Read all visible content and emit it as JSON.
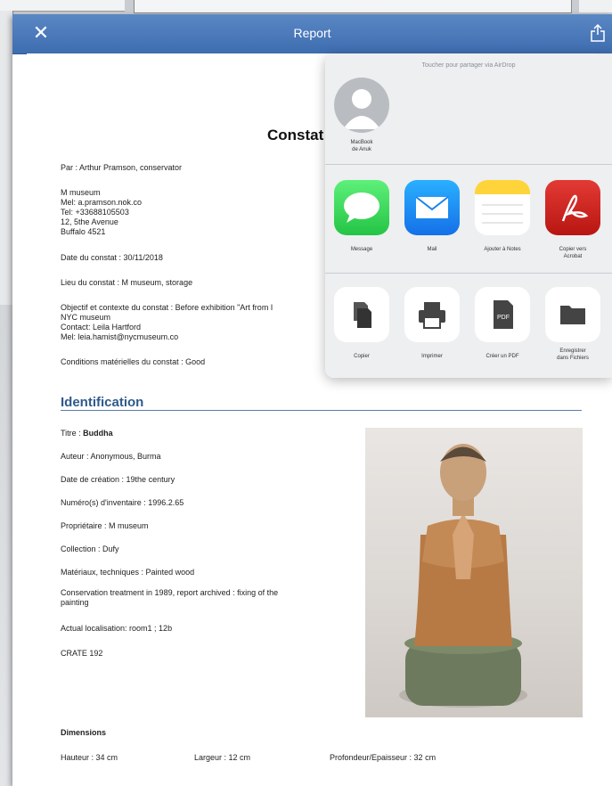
{
  "navbar": {
    "title": "Report"
  },
  "share_sheet": {
    "hint": "Toucher pour partager via AirDrop",
    "airdrop_person": {
      "line1": "MacBook",
      "line2": "de Anuk"
    },
    "apps": [
      {
        "label": "Message",
        "icon": "message-icon",
        "color": "#34c759"
      },
      {
        "label": "Mail",
        "icon": "mail-icon",
        "color": "#1a82f5"
      },
      {
        "label": "Ajouter à Notes",
        "icon": "notes-icon",
        "color": "#ffd43a"
      },
      {
        "label_line1": "Copier vers",
        "label_line2": "Acrobat",
        "icon": "acrobat-icon",
        "color": "#d9231f"
      }
    ],
    "actions": [
      {
        "label": "Copier",
        "icon": "copy-icon"
      },
      {
        "label": "Imprimer",
        "icon": "print-icon"
      },
      {
        "label": "Créer un PDF",
        "icon": "pdf-icon",
        "icon_text": "PDF"
      },
      {
        "label_line1": "Enregistrer",
        "label_line2": "dans Fichiers",
        "icon": "folder-icon"
      }
    ]
  },
  "report": {
    "title": "Constat",
    "author": "Par : Arthur Pramson, conservator",
    "contact": [
      "M museum",
      "Mel: a.pramson.nok.co",
      "Tel: +33688105503",
      "12, 5the Avenue",
      "Buffalo 4521"
    ],
    "date": "Date du constat : 30/11/2018",
    "place": "Lieu du constat : M museum, storage",
    "objective": [
      "Objectif et contexte du constat : Before exhibition \"Art from I",
      "NYC museum",
      "Contact: Leila Hartford",
      "Mel: leia.hamist@nycmuseum.co"
    ],
    "conditions": "Conditions matérielles du constat : Good",
    "identification": {
      "heading": "Identification",
      "title_label": "Titre : ",
      "title_value": "Buddha",
      "author": "Auteur : Anonymous, Burma",
      "creation": "Date de création : 19the century",
      "inventory": "Numéro(s) d'inventaire : 1996.2.65",
      "owner": "Propriétaire : M museum",
      "collection": "Collection : Dufy",
      "materials": "Matériaux, techniques : Painted wood",
      "treatment": [
        "Conservation treatment in 1989, report archived : fixing of the",
        "painting"
      ],
      "location": "Actual localisation: room1 ; 12b",
      "crate": "CRATE 192"
    },
    "dimensions": {
      "heading": "Dimensions",
      "height": "Hauteur : 34 cm",
      "width": "Largeur : 12 cm",
      "depth": "Profondeur/Epaisseur : 32 cm"
    }
  }
}
